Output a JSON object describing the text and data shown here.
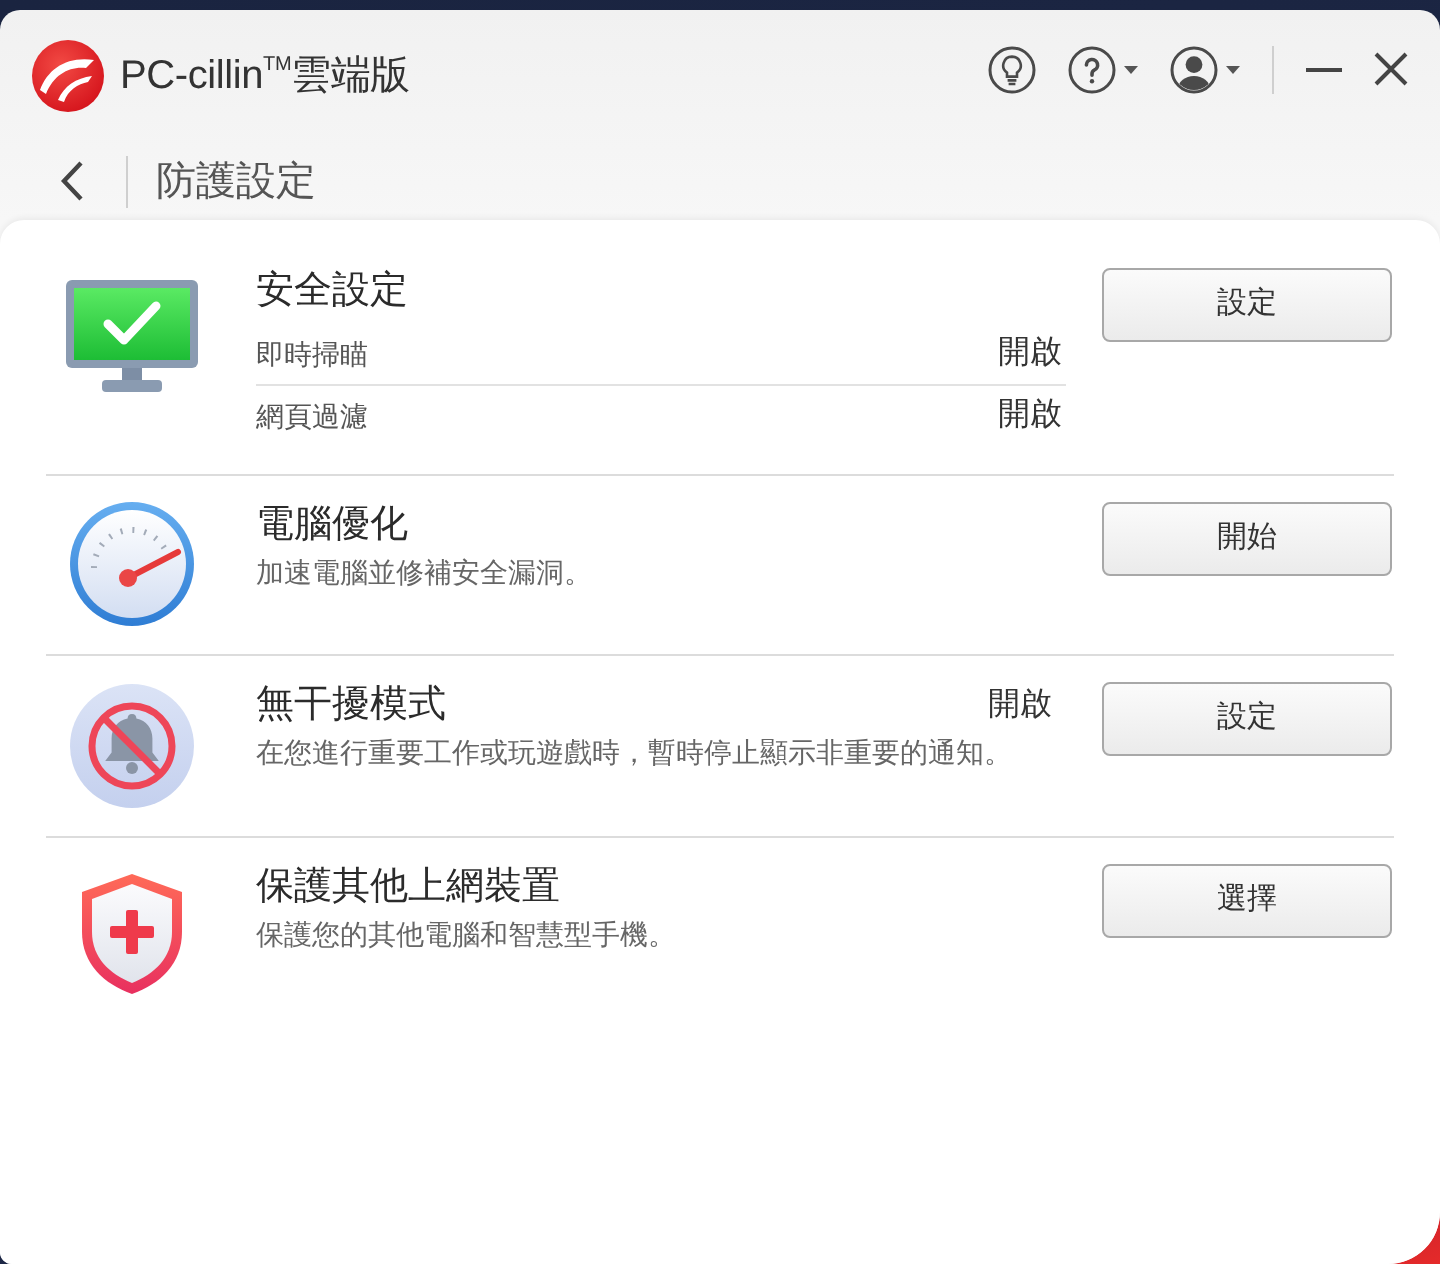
{
  "window": {
    "title": "PC-cillin$^{TM}$雲端版"
  },
  "page": {
    "title": "防護設定"
  },
  "sections": [
    {
      "kind": "settings",
      "title": "安全設定",
      "items": [
        {
          "label": "即時掃瞄",
          "status": "開啟"
        },
        {
          "label": "網頁過濾",
          "status": "開啟"
        }
      ],
      "button": "設定"
    },
    {
      "kind": "action",
      "title": "電腦優化",
      "description": "加速電腦並修補安全漏洞。",
      "button": "開始"
    },
    {
      "kind": "action",
      "title": "無干擾模式",
      "status": "開啟",
      "description": "在您進行重要工作或玩遊戲時，暫時停止顯示非重要的通知。",
      "button": "設定"
    },
    {
      "kind": "action",
      "title": "保護其他上網裝置",
      "description": "保護您的其他電腦和智慧型手機。",
      "button": "選擇"
    }
  ]
}
